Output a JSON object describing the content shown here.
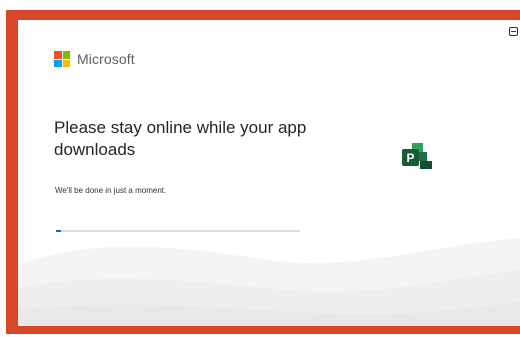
{
  "brand": {
    "name": "Microsoft",
    "logo_icon": "microsoft-logo-icon",
    "logo_colors": [
      "#f25022",
      "#7fba00",
      "#00a4ef",
      "#ffb900"
    ]
  },
  "main": {
    "headline": "Please stay online while your app downloads",
    "subtext": "We'll be done in just a moment.",
    "progress": 0.02
  },
  "app_icon": "microsoft-project-icon",
  "window_controls": {
    "minimize_icon": "minimize-icon"
  },
  "colors": {
    "frame": "#d9472b",
    "progress_fill": "#0f6cbd",
    "progress_track": "#dcdcdc",
    "project_green": "#1e7145"
  }
}
